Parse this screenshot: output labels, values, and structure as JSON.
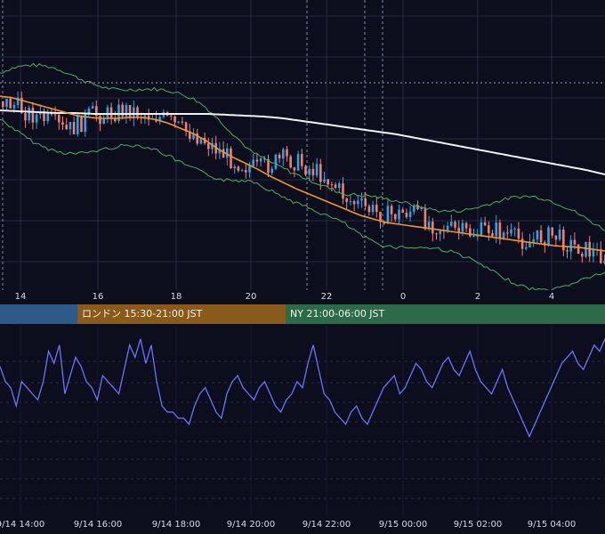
{
  "colors": {
    "background": "#0c0e1d",
    "grid": "#262a44",
    "candle_up": "#2aa2e6",
    "candle_down": "#f07e73",
    "ma_fast": "#f0962a",
    "ma_slow": "#f2f2f2",
    "band": "#4caf62",
    "oscillator": "#6b73ff",
    "session_tokyo": "#2e5a8a",
    "session_london": "#8a5a1a",
    "session_ny": "#2d6a47"
  },
  "x_ticks_top": [
    "14",
    "16",
    "18",
    "20",
    "22",
    "0",
    "2",
    "4"
  ],
  "x_ticks_bottom": [
    "9/14 14:00",
    "9/14 16:00",
    "9/14 18:00",
    "9/14 20:00",
    "9/14 22:00",
    "9/15 00:00",
    "9/15 02:00",
    "9/15 04:00"
  ],
  "sessions": [
    {
      "label": "",
      "color": "#2e5a8a"
    },
    {
      "label": "ロンドン 15:30-21:00 JST",
      "color": "#8a5a1a"
    },
    {
      "label": "NY 21:00-06:00 JST",
      "color": "#2d6a47"
    }
  ],
  "chart_data": [
    {
      "type": "candlestick",
      "title": "",
      "x_range": [
        "9/14 13:10",
        "9/15 05:30"
      ],
      "indicators": [
        "moving average (fast)",
        "moving average (slow)",
        "bollinger bands"
      ],
      "grid": true,
      "price_path": [
        114,
        118,
        126,
        132,
        138,
        148,
        140,
        128,
        130,
        125,
        123,
        128,
        130,
        136,
        146,
        150,
        160,
        170,
        180,
        186,
        190,
        184,
        178,
        182,
        190,
        196,
        210,
        225,
        232,
        238,
        242,
        240,
        236,
        248,
        255,
        258,
        262,
        262,
        256,
        262,
        268,
        272,
        266,
        264,
        274,
        278,
        284,
        288
      ],
      "ma_fast_path": [
        108,
        110,
        114,
        118,
        122,
        126,
        130,
        132,
        133,
        133,
        132,
        132,
        134,
        138,
        144,
        150,
        158,
        168,
        176,
        183,
        190,
        198,
        205,
        212,
        218,
        224,
        230,
        236,
        242,
        246,
        250,
        252,
        254,
        256,
        258,
        260,
        262,
        264,
        266,
        268,
        270,
        272,
        274,
        276,
        277,
        278,
        280,
        282
      ],
      "ma_slow_path": [
        124,
        125,
        126,
        127,
        127,
        128,
        128,
        128,
        128,
        128,
        128,
        128,
        129,
        130,
        131,
        133,
        136,
        139,
        142,
        145,
        148,
        151,
        155,
        159,
        163,
        167,
        171,
        175,
        179,
        183,
        187,
        191,
        196
      ]
    },
    {
      "type": "line",
      "title": "",
      "grid": true,
      "values": [
        55,
        50,
        48,
        42,
        50,
        48,
        46,
        44,
        50,
        60,
        56,
        62,
        46,
        52,
        58,
        55,
        50,
        48,
        44,
        52,
        50,
        48,
        46,
        54,
        62,
        58,
        64,
        56,
        62,
        50,
        42,
        40,
        40,
        38,
        38,
        36,
        42,
        46,
        48,
        44,
        40,
        38,
        46,
        50,
        52,
        48,
        46,
        44,
        48,
        50,
        46,
        42,
        40,
        44,
        46,
        50,
        48,
        56,
        62,
        54,
        46,
        44,
        40,
        38,
        36,
        40,
        42,
        38,
        36,
        40,
        44,
        48,
        50,
        52,
        46,
        48,
        52,
        56,
        54,
        50,
        48,
        52,
        56,
        58,
        54,
        52,
        56,
        60,
        54,
        50,
        48,
        46,
        50,
        54,
        48,
        44,
        40,
        36,
        32,
        36,
        40,
        44,
        48,
        52,
        56,
        58,
        60,
        56,
        54,
        58,
        62,
        60,
        64
      ]
    }
  ]
}
